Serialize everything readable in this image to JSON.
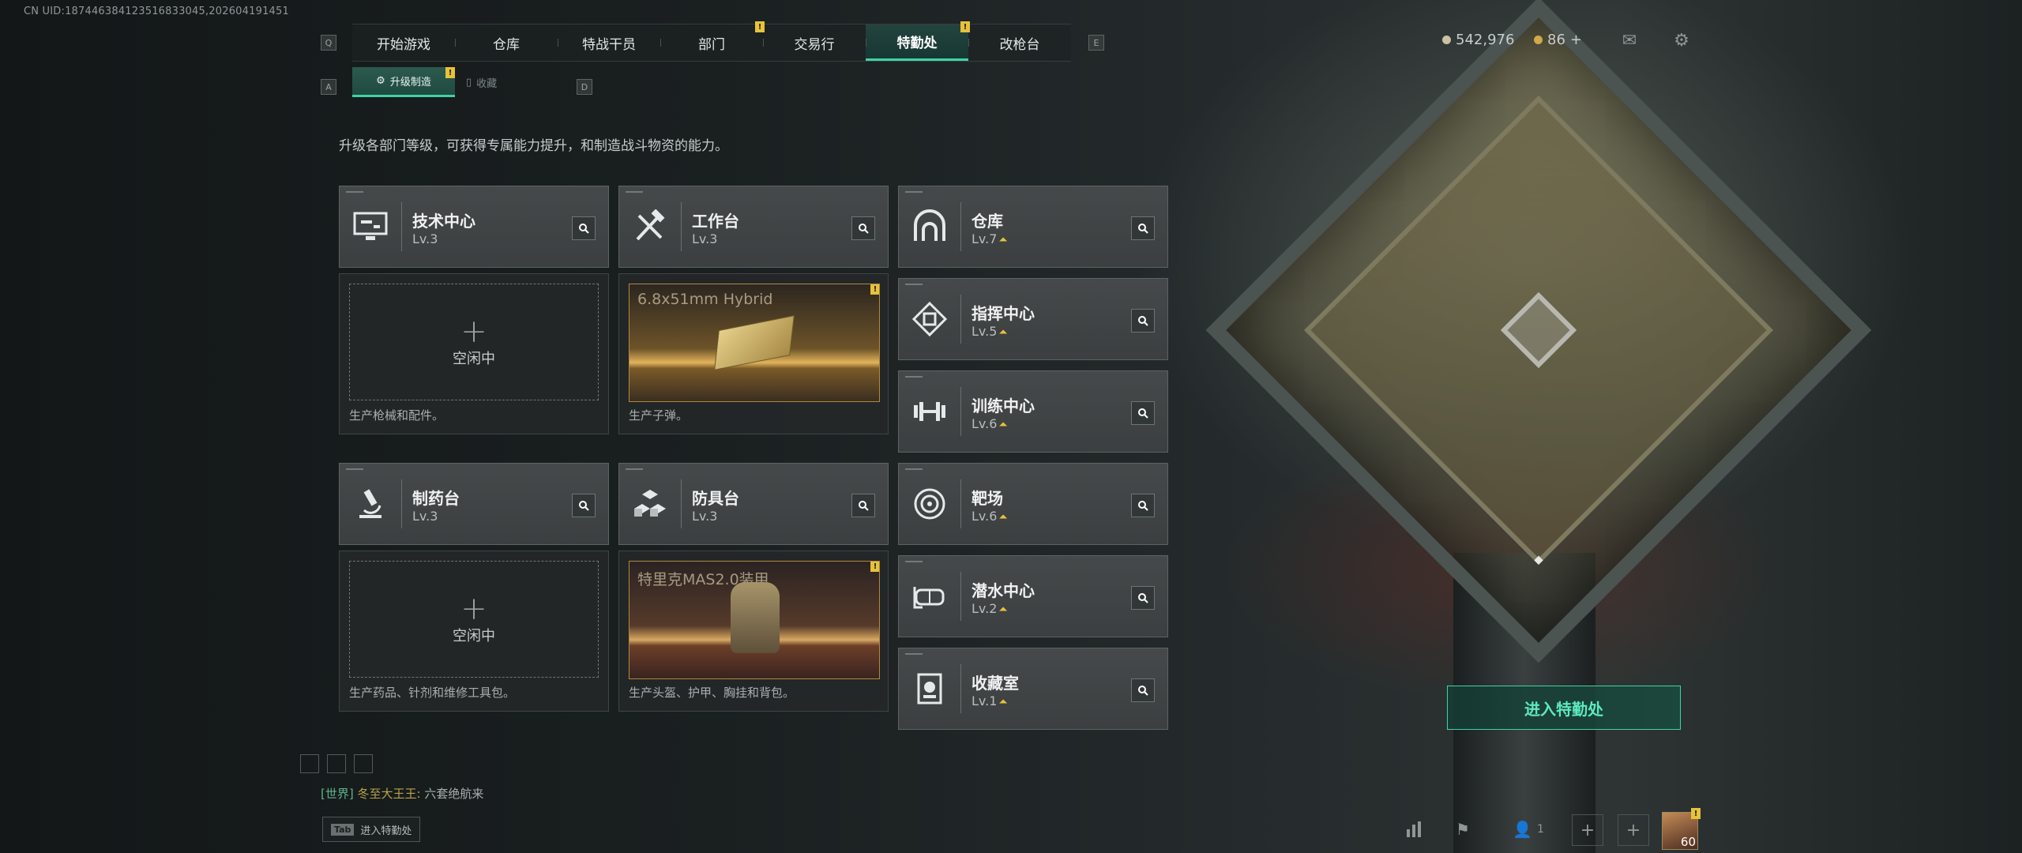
{
  "uid_text": "CN UID:187446384123516833045,202604191451",
  "nav": {
    "key_left": "Q",
    "key_right": "E",
    "tabs": [
      {
        "label": "开始游戏"
      },
      {
        "label": "仓库"
      },
      {
        "label": "特战干员"
      },
      {
        "label": "部门",
        "badge": "!"
      },
      {
        "label": "交易行"
      },
      {
        "label": "特勤处",
        "badge": "!",
        "active": true
      },
      {
        "label": "改枪台"
      }
    ]
  },
  "subnav": {
    "key_left": "A",
    "key_right": "D",
    "tabs": [
      {
        "label": "升级制造",
        "badge": "!",
        "active": true
      },
      {
        "label": "收藏"
      }
    ]
  },
  "currency": {
    "coins": "542,976",
    "gold": "86",
    "gold_add": "+"
  },
  "description": "升级各部门等级，可获得专属能力提升，和制造战斗物资的能力。",
  "departments": [
    {
      "name": "技术中心",
      "level": "Lv.3",
      "icon": "monitor-icon"
    },
    {
      "name": "工作台",
      "level": "Lv.3",
      "icon": "tools-icon"
    },
    {
      "name": "制药台",
      "level": "Lv.3",
      "icon": "microscope-icon"
    },
    {
      "name": "防具台",
      "level": "Lv.3",
      "icon": "cubes-icon"
    }
  ],
  "right_departments": [
    {
      "name": "仓库",
      "level": "Lv.7",
      "icon": "storage-arch-icon",
      "upgradable": true
    },
    {
      "name": "指挥中心",
      "level": "Lv.5",
      "icon": "command-chip-icon",
      "upgradable": true
    },
    {
      "name": "训练中心",
      "level": "Lv.6",
      "icon": "dumbbell-icon",
      "upgradable": true
    },
    {
      "name": "靶场",
      "level": "Lv.6",
      "icon": "target-icon",
      "upgradable": true
    },
    {
      "name": "潜水中心",
      "level": "Lv.2",
      "icon": "diving-mask-icon",
      "upgradable": true
    },
    {
      "name": "收藏室",
      "level": "Lv.1",
      "icon": "trophy-icon",
      "upgradable": true
    }
  ],
  "slots": [
    {
      "status": "空闲中",
      "plus": "+",
      "note": "生产枪械和配件。"
    },
    {
      "product": "6.8x51mm Hybrid",
      "note": "生产子弹。",
      "badge": "!"
    },
    {
      "status": "空闲中",
      "plus": "+",
      "note": "生产药品、针剂和维修工具包。"
    },
    {
      "product": "特里克MAS2.0装甲",
      "note": "生产头盔、护甲、胸挂和背包。",
      "badge": "!"
    }
  ],
  "enter_button": "进入特勤处",
  "chat": {
    "channel": "[世界]",
    "user": "冬至大王王:",
    "message": "六套绝航来"
  },
  "tab_hint": {
    "key": "Tab",
    "label": "进入特勤处"
  },
  "bottom": {
    "squad_count": "1",
    "player_level": "60",
    "player_badge": "!"
  },
  "colors": {
    "accent": "#3fd3a5",
    "badge": "#e7c23a",
    "upgrade_arrow": "#e7c23a"
  }
}
